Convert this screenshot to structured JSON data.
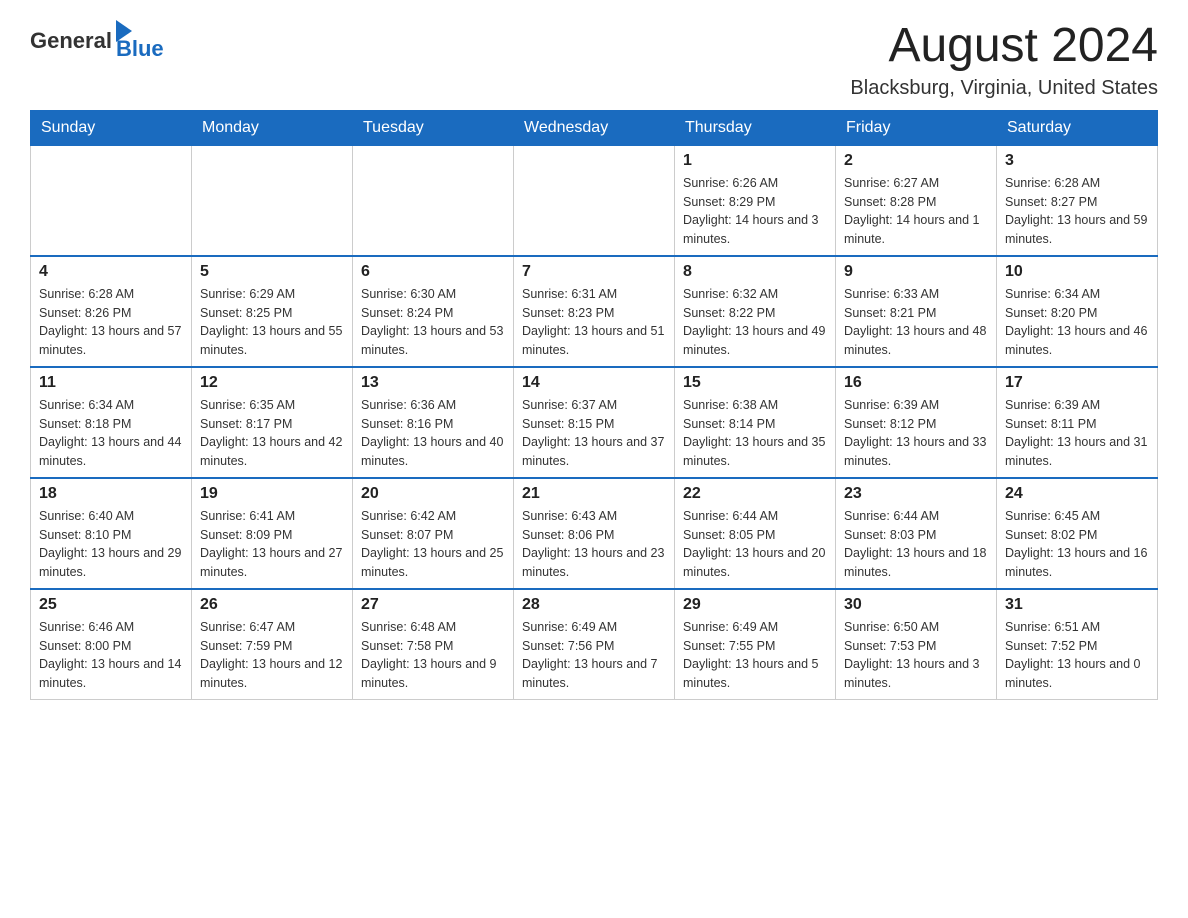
{
  "header": {
    "logo_general": "General",
    "logo_blue": "Blue",
    "title": "August 2024",
    "location": "Blacksburg, Virginia, United States"
  },
  "days_of_week": [
    "Sunday",
    "Monday",
    "Tuesday",
    "Wednesday",
    "Thursday",
    "Friday",
    "Saturday"
  ],
  "weeks": [
    [
      {
        "day": "",
        "sunrise": "",
        "sunset": "",
        "daylight": ""
      },
      {
        "day": "",
        "sunrise": "",
        "sunset": "",
        "daylight": ""
      },
      {
        "day": "",
        "sunrise": "",
        "sunset": "",
        "daylight": ""
      },
      {
        "day": "",
        "sunrise": "",
        "sunset": "",
        "daylight": ""
      },
      {
        "day": "1",
        "sunrise": "Sunrise: 6:26 AM",
        "sunset": "Sunset: 8:29 PM",
        "daylight": "Daylight: 14 hours and 3 minutes."
      },
      {
        "day": "2",
        "sunrise": "Sunrise: 6:27 AM",
        "sunset": "Sunset: 8:28 PM",
        "daylight": "Daylight: 14 hours and 1 minute."
      },
      {
        "day": "3",
        "sunrise": "Sunrise: 6:28 AM",
        "sunset": "Sunset: 8:27 PM",
        "daylight": "Daylight: 13 hours and 59 minutes."
      }
    ],
    [
      {
        "day": "4",
        "sunrise": "Sunrise: 6:28 AM",
        "sunset": "Sunset: 8:26 PM",
        "daylight": "Daylight: 13 hours and 57 minutes."
      },
      {
        "day": "5",
        "sunrise": "Sunrise: 6:29 AM",
        "sunset": "Sunset: 8:25 PM",
        "daylight": "Daylight: 13 hours and 55 minutes."
      },
      {
        "day": "6",
        "sunrise": "Sunrise: 6:30 AM",
        "sunset": "Sunset: 8:24 PM",
        "daylight": "Daylight: 13 hours and 53 minutes."
      },
      {
        "day": "7",
        "sunrise": "Sunrise: 6:31 AM",
        "sunset": "Sunset: 8:23 PM",
        "daylight": "Daylight: 13 hours and 51 minutes."
      },
      {
        "day": "8",
        "sunrise": "Sunrise: 6:32 AM",
        "sunset": "Sunset: 8:22 PM",
        "daylight": "Daylight: 13 hours and 49 minutes."
      },
      {
        "day": "9",
        "sunrise": "Sunrise: 6:33 AM",
        "sunset": "Sunset: 8:21 PM",
        "daylight": "Daylight: 13 hours and 48 minutes."
      },
      {
        "day": "10",
        "sunrise": "Sunrise: 6:34 AM",
        "sunset": "Sunset: 8:20 PM",
        "daylight": "Daylight: 13 hours and 46 minutes."
      }
    ],
    [
      {
        "day": "11",
        "sunrise": "Sunrise: 6:34 AM",
        "sunset": "Sunset: 8:18 PM",
        "daylight": "Daylight: 13 hours and 44 minutes."
      },
      {
        "day": "12",
        "sunrise": "Sunrise: 6:35 AM",
        "sunset": "Sunset: 8:17 PM",
        "daylight": "Daylight: 13 hours and 42 minutes."
      },
      {
        "day": "13",
        "sunrise": "Sunrise: 6:36 AM",
        "sunset": "Sunset: 8:16 PM",
        "daylight": "Daylight: 13 hours and 40 minutes."
      },
      {
        "day": "14",
        "sunrise": "Sunrise: 6:37 AM",
        "sunset": "Sunset: 8:15 PM",
        "daylight": "Daylight: 13 hours and 37 minutes."
      },
      {
        "day": "15",
        "sunrise": "Sunrise: 6:38 AM",
        "sunset": "Sunset: 8:14 PM",
        "daylight": "Daylight: 13 hours and 35 minutes."
      },
      {
        "day": "16",
        "sunrise": "Sunrise: 6:39 AM",
        "sunset": "Sunset: 8:12 PM",
        "daylight": "Daylight: 13 hours and 33 minutes."
      },
      {
        "day": "17",
        "sunrise": "Sunrise: 6:39 AM",
        "sunset": "Sunset: 8:11 PM",
        "daylight": "Daylight: 13 hours and 31 minutes."
      }
    ],
    [
      {
        "day": "18",
        "sunrise": "Sunrise: 6:40 AM",
        "sunset": "Sunset: 8:10 PM",
        "daylight": "Daylight: 13 hours and 29 minutes."
      },
      {
        "day": "19",
        "sunrise": "Sunrise: 6:41 AM",
        "sunset": "Sunset: 8:09 PM",
        "daylight": "Daylight: 13 hours and 27 minutes."
      },
      {
        "day": "20",
        "sunrise": "Sunrise: 6:42 AM",
        "sunset": "Sunset: 8:07 PM",
        "daylight": "Daylight: 13 hours and 25 minutes."
      },
      {
        "day": "21",
        "sunrise": "Sunrise: 6:43 AM",
        "sunset": "Sunset: 8:06 PM",
        "daylight": "Daylight: 13 hours and 23 minutes."
      },
      {
        "day": "22",
        "sunrise": "Sunrise: 6:44 AM",
        "sunset": "Sunset: 8:05 PM",
        "daylight": "Daylight: 13 hours and 20 minutes."
      },
      {
        "day": "23",
        "sunrise": "Sunrise: 6:44 AM",
        "sunset": "Sunset: 8:03 PM",
        "daylight": "Daylight: 13 hours and 18 minutes."
      },
      {
        "day": "24",
        "sunrise": "Sunrise: 6:45 AM",
        "sunset": "Sunset: 8:02 PM",
        "daylight": "Daylight: 13 hours and 16 minutes."
      }
    ],
    [
      {
        "day": "25",
        "sunrise": "Sunrise: 6:46 AM",
        "sunset": "Sunset: 8:00 PM",
        "daylight": "Daylight: 13 hours and 14 minutes."
      },
      {
        "day": "26",
        "sunrise": "Sunrise: 6:47 AM",
        "sunset": "Sunset: 7:59 PM",
        "daylight": "Daylight: 13 hours and 12 minutes."
      },
      {
        "day": "27",
        "sunrise": "Sunrise: 6:48 AM",
        "sunset": "Sunset: 7:58 PM",
        "daylight": "Daylight: 13 hours and 9 minutes."
      },
      {
        "day": "28",
        "sunrise": "Sunrise: 6:49 AM",
        "sunset": "Sunset: 7:56 PM",
        "daylight": "Daylight: 13 hours and 7 minutes."
      },
      {
        "day": "29",
        "sunrise": "Sunrise: 6:49 AM",
        "sunset": "Sunset: 7:55 PM",
        "daylight": "Daylight: 13 hours and 5 minutes."
      },
      {
        "day": "30",
        "sunrise": "Sunrise: 6:50 AM",
        "sunset": "Sunset: 7:53 PM",
        "daylight": "Daylight: 13 hours and 3 minutes."
      },
      {
        "day": "31",
        "sunrise": "Sunrise: 6:51 AM",
        "sunset": "Sunset: 7:52 PM",
        "daylight": "Daylight: 13 hours and 0 minutes."
      }
    ]
  ]
}
